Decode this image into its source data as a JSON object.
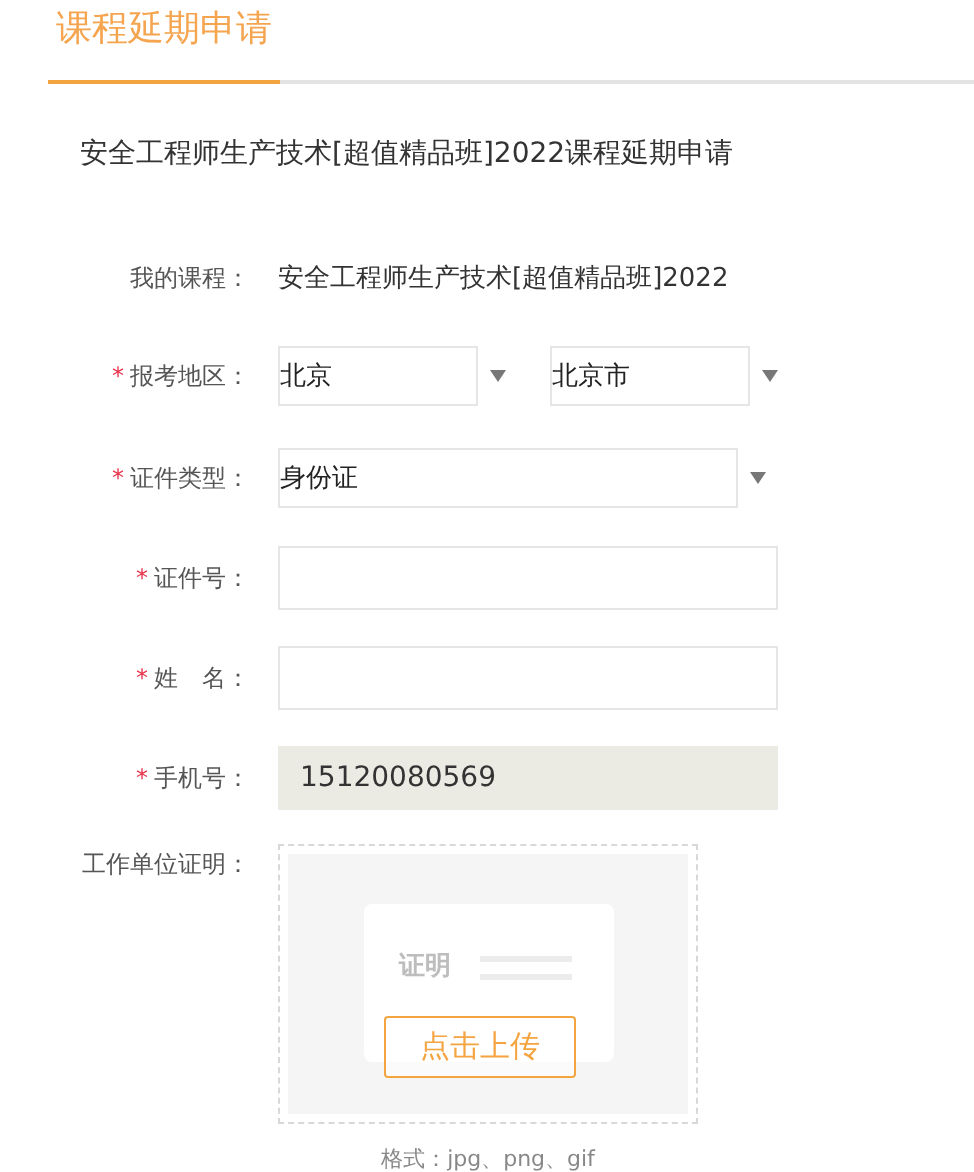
{
  "tab": {
    "label": "课程延期申请",
    "selected": true
  },
  "heading": "安全工程师生产技术[超值精品班]2022课程延期申请",
  "fields": [
    {
      "kind": "text",
      "label": "我的课程：",
      "value": "安全工程师生产技术[超值精品班]2022"
    },
    {
      "kind": "select_pair",
      "required_mark": "*",
      "label": "报考地区：",
      "values": [
        "北京",
        "北京市"
      ]
    },
    {
      "kind": "select",
      "required_mark": "*",
      "label": "证件类型：",
      "value": "身份证"
    },
    {
      "kind": "input",
      "required_mark": "*",
      "label": "证件号："
    },
    {
      "kind": "input",
      "required_mark": "*",
      "label": "姓　名："
    },
    {
      "kind": "readonly",
      "required_mark": "*",
      "label": "手机号：",
      "value": "15120080569"
    },
    {
      "kind": "upload",
      "label": "工作单位证明：",
      "sample_label": "证明",
      "button": "点击上传",
      "hint": "格式：jpg、png、gif"
    }
  ]
}
